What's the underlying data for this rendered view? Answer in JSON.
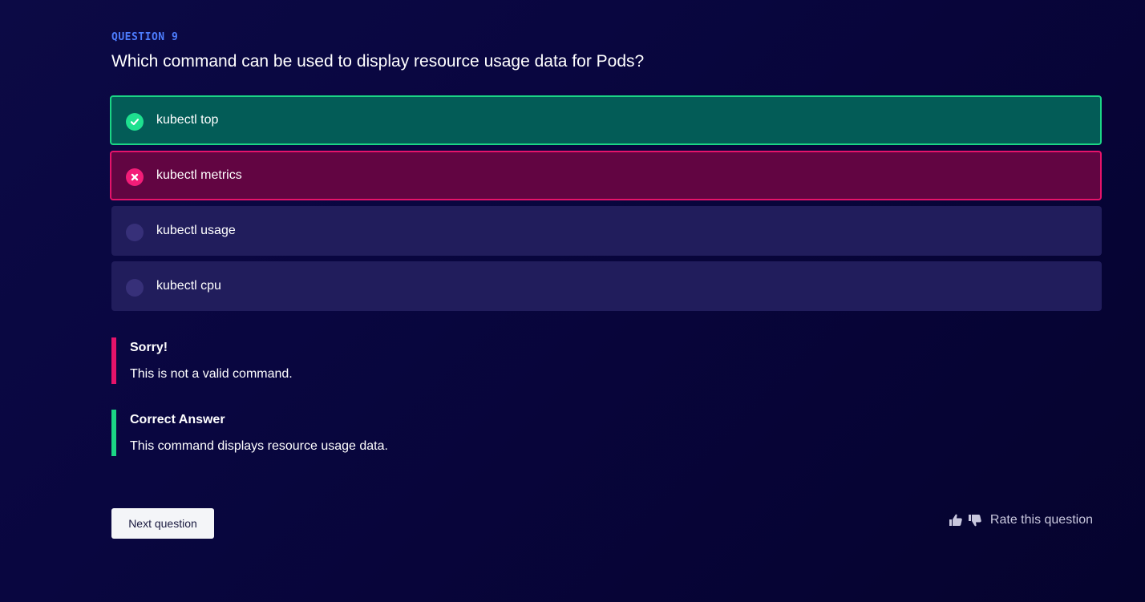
{
  "question": {
    "label": "QUESTION 9",
    "text": "Which command can be used to display resource usage data for Pods?"
  },
  "options": [
    {
      "label": "kubectl top",
      "state": "correct",
      "icon": "check-circle-icon"
    },
    {
      "label": "kubectl metrics",
      "state": "wrong",
      "icon": "x-circle-icon"
    },
    {
      "label": "kubectl usage",
      "state": "unselected",
      "icon": "empty-radio-icon"
    },
    {
      "label": "kubectl cpu",
      "state": "unselected",
      "icon": "empty-radio-icon"
    }
  ],
  "feedback": {
    "sorry_title": "Sorry!",
    "sorry_body": "This is not a valid command.",
    "answer_title": "Correct Answer",
    "answer_body": "This command displays resource usage data."
  },
  "footer": {
    "next_label": "Next question",
    "rate_label": "Rate this question",
    "thumbs_up_icon": "thumbs-up-icon",
    "thumbs_down_icon": "thumbs-down-icon"
  },
  "colors": {
    "background": "#0a0742",
    "accent_blue": "#4d7dff",
    "correct": "#1bd585",
    "correct_bg": "#035c57",
    "wrong": "#e6136a",
    "wrong_bg": "#620542",
    "option_bg": "#211d5c"
  }
}
